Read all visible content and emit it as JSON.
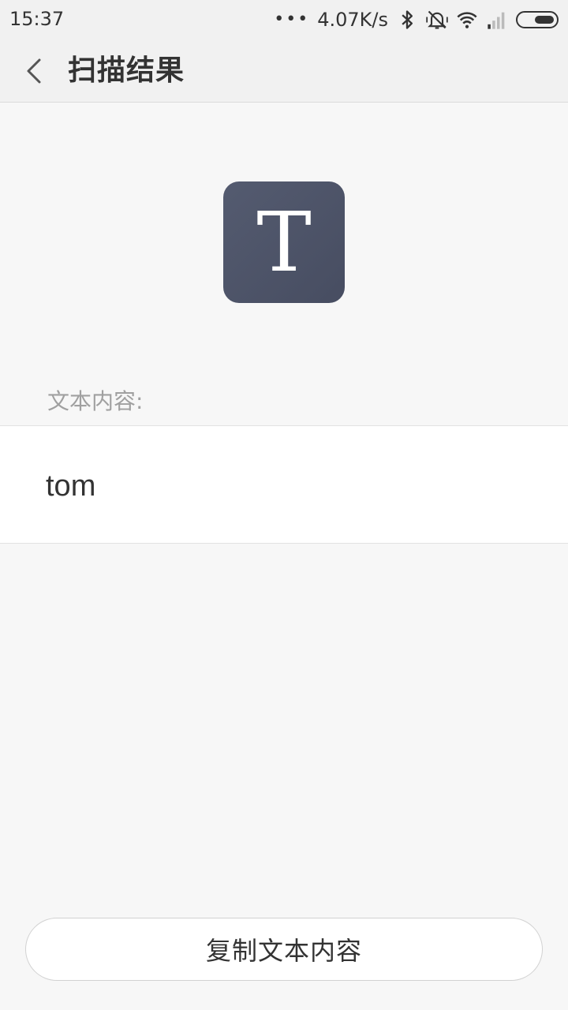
{
  "status_bar": {
    "time": "15:37",
    "dots": "•••",
    "network_speed": "4.07K/s",
    "icons": [
      "bluetooth-icon",
      "mute-icon",
      "wifi-icon",
      "signal-icon",
      "battery-icon"
    ]
  },
  "header": {
    "back_icon": "chevron-left-icon",
    "title": "扫描结果"
  },
  "result": {
    "type_icon_letter": "T",
    "content_label": "文本内容:",
    "content_text": "tom"
  },
  "actions": {
    "copy_label": "复制文本内容"
  },
  "colors": {
    "background": "#f7f7f7",
    "icon_tile": "#4c5266",
    "label_gray": "#a0a0a0",
    "text_dark": "#333333"
  }
}
